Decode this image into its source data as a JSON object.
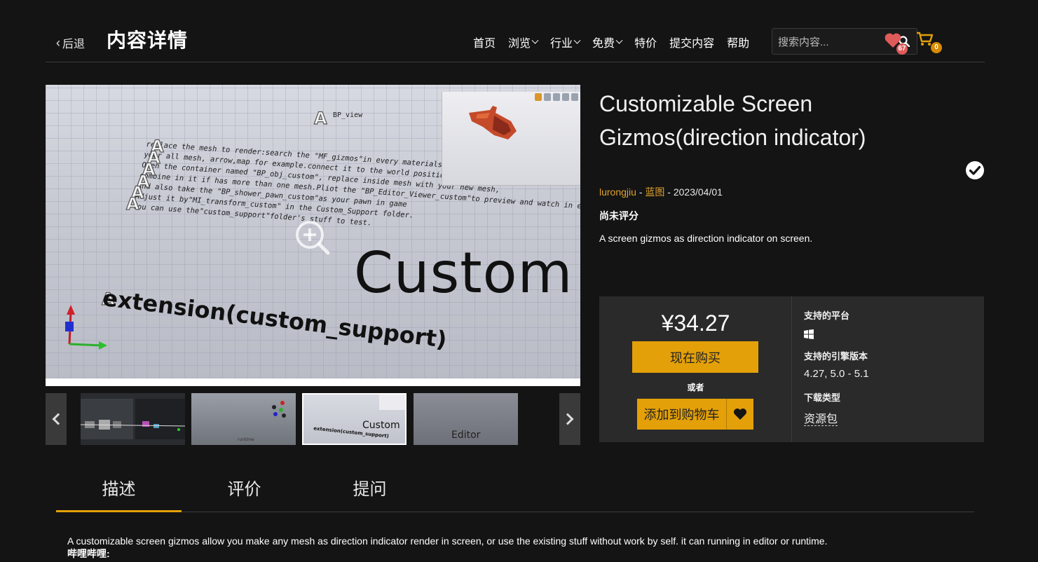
{
  "header": {
    "back_label": "后退",
    "page_title": "内容详情",
    "nav": [
      {
        "label": "首页",
        "dropdown": false
      },
      {
        "label": "浏览",
        "dropdown": true
      },
      {
        "label": "行业",
        "dropdown": true
      },
      {
        "label": "免费",
        "dropdown": true
      },
      {
        "label": "特价",
        "dropdown": false
      },
      {
        "label": "提交内容",
        "dropdown": false
      },
      {
        "label": "帮助",
        "dropdown": false
      }
    ],
    "search_placeholder": "搜索内容...",
    "favorites_count": "67",
    "cart_count": "0"
  },
  "gallery": {
    "image_text": {
      "bp_view": "BP_view",
      "instructions": [
        "replace the mesh to render:search the \"MF_gizmos\"in every materials of",
        "your all mesh, arrow,map for example.connect it to the world position offset pin.",
        "Open the container named \"BP_obj_custom\", replace inside mesh with your new mesh,",
        "combine in it if has more than one mesh.Pliot the \"BP_Editor_Viewer_custom\"to preview and watch in editor.",
        "And also take the \"BP_shower_pawn_custom\"as your pawn in game",
        "Adjust it by\"MI_transform_custom\" in the Custom_Support folder.",
        "You can use the\"custom_support\"folder's stuff to test."
      ],
      "big_word": "Custom",
      "extension_text": "extension(custom_support)",
      "thumb3_label": "Custom",
      "thumb3_sub": "extension(custom_support)",
      "thumb4_label": "Editor",
      "thumb2_label": "runtime"
    }
  },
  "product": {
    "title": "Customizable Screen Gizmos(direction indicator)",
    "author": "lurongjiu",
    "separator": " - ",
    "category": "蓝图",
    "date": "2023/04/01",
    "rating": "尚未评分",
    "short_description": "A screen gizmos as direction indicator on screen.",
    "price": "¥34.27",
    "buy_now": "现在购买",
    "or": "或者",
    "add_to_cart": "添加到购物车",
    "platform_heading": "支持的平台",
    "engine_heading": "支持的引擎版本",
    "engine_versions": "4.27, 5.0 - 5.1",
    "download_heading": "下载类型",
    "download_type": "资源包"
  },
  "tabs": [
    {
      "label": "描述",
      "active": true
    },
    {
      "label": "评价",
      "active": false
    },
    {
      "label": "提问",
      "active": false
    }
  ],
  "description": {
    "line1": "A customizable screen gizmos allow you make any mesh as direction indicator render in screen, or use the existing stuff without work by self. it can running in editor or runtime.",
    "line2": "哔哩哔哩:"
  },
  "colors": {
    "accent": "#e3a008",
    "background": "#141414",
    "panel": "#2a2a2a",
    "favorite": "#e05a5a"
  }
}
